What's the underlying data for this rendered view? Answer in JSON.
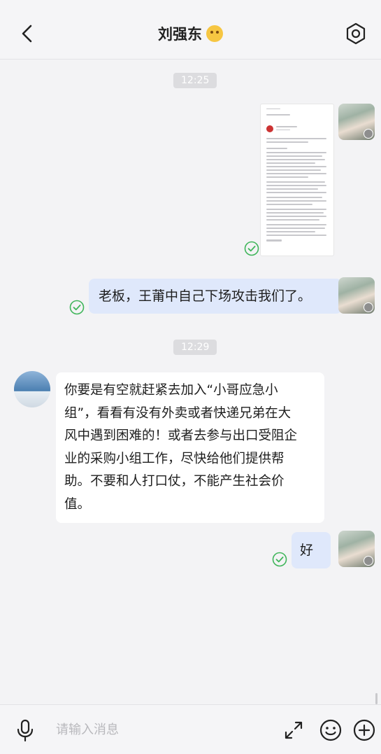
{
  "header": {
    "title": "刘强东",
    "title_emoji": "cowboy-face-emoji",
    "back_icon": "chevron-left-icon",
    "settings_icon": "hexagon-gear-icon"
  },
  "messages": [
    {
      "type": "time",
      "text": "12:25"
    },
    {
      "type": "image",
      "sender": "me",
      "status": "sent-check"
    },
    {
      "type": "text",
      "sender": "me",
      "text": "老板，王莆中自己下场攻击我们了。",
      "status": "sent-check"
    },
    {
      "type": "time",
      "text": "12:29"
    },
    {
      "type": "text",
      "sender": "other",
      "lines": [
        "你要是有空就赶紧去加入“小哥应急小",
        "组”，看看有没有外卖或者快递兄弟在大",
        "风中遇到困难的！或者去参与出口受阻企",
        "业的采购小组工作，尽快给他们提供帮",
        "助。不要和人打口仗，不能产生社会价",
        "值。"
      ]
    },
    {
      "type": "text",
      "sender": "me",
      "text": "好",
      "status": "sent-check"
    }
  ],
  "input": {
    "placeholder": "请输入消息",
    "value": ""
  },
  "colors": {
    "background": "#f3f3f5",
    "bubble_me": "#dfe8fb",
    "bubble_other": "#ffffff",
    "check_green": "#3fb55a",
    "time_pill": "#dcdcdf"
  }
}
